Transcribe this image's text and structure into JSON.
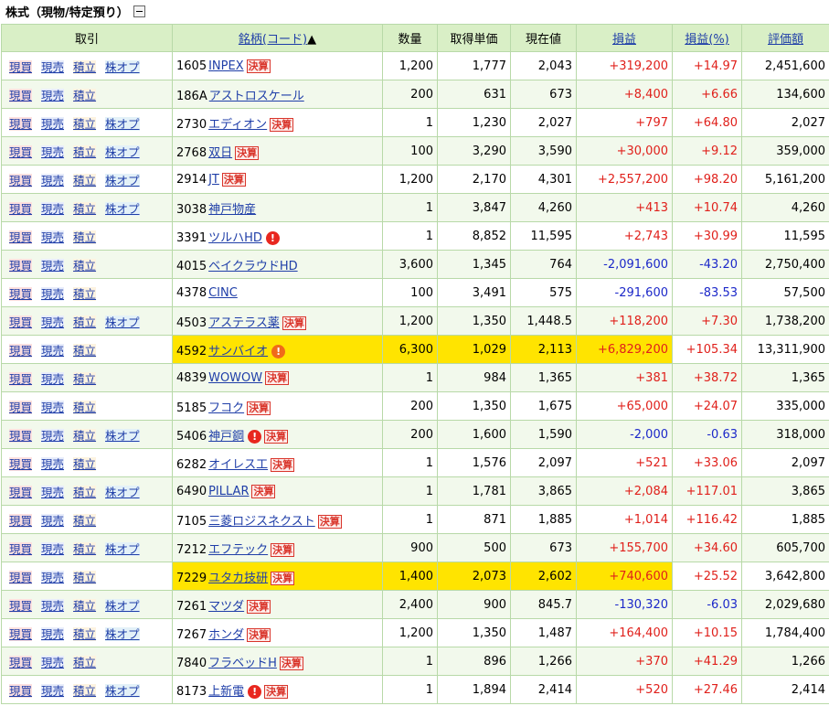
{
  "header": {
    "title": "株式（現物/特定預り）"
  },
  "columns": {
    "trade": "取引",
    "name": "銘柄(コード)",
    "sort_mark": "▲",
    "qty": "数量",
    "cost": "取得単価",
    "price": "現在値",
    "pl": "損益",
    "plpct": "損益(%)",
    "value": "評価額"
  },
  "trade_labels": {
    "buy": "現買",
    "sell": "現売",
    "tsumi": "積立",
    "opt": "株オプ"
  },
  "kessan_label": "決算",
  "alert_glyph": "!",
  "rows": [
    {
      "code": "1605",
      "name": "INPEX",
      "opt": true,
      "kessan": true,
      "alert": "",
      "qty": "1,200",
      "cost": "1,777",
      "price": "2,043",
      "pl": "+319,200",
      "plpct": "+14.97",
      "value": "2,451,600",
      "hl": false
    },
    {
      "code": "186A",
      "name": "アストロスケール",
      "opt": false,
      "kessan": false,
      "alert": "",
      "qty": "200",
      "cost": "631",
      "price": "673",
      "pl": "+8,400",
      "plpct": "+6.66",
      "value": "134,600",
      "hl": false
    },
    {
      "code": "2730",
      "name": "エディオン",
      "opt": true,
      "kessan": true,
      "alert": "",
      "qty": "1",
      "cost": "1,230",
      "price": "2,027",
      "pl": "+797",
      "plpct": "+64.80",
      "value": "2,027",
      "hl": false
    },
    {
      "code": "2768",
      "name": "双日",
      "opt": true,
      "kessan": true,
      "alert": "",
      "qty": "100",
      "cost": "3,290",
      "price": "3,590",
      "pl": "+30,000",
      "plpct": "+9.12",
      "value": "359,000",
      "hl": false
    },
    {
      "code": "2914",
      "name": "JT",
      "opt": true,
      "kessan": true,
      "alert": "",
      "qty": "1,200",
      "cost": "2,170",
      "price": "4,301",
      "pl": "+2,557,200",
      "plpct": "+98.20",
      "value": "5,161,200",
      "hl": false
    },
    {
      "code": "3038",
      "name": "神戸物産",
      "opt": true,
      "kessan": false,
      "alert": "",
      "qty": "1",
      "cost": "3,847",
      "price": "4,260",
      "pl": "+413",
      "plpct": "+10.74",
      "value": "4,260",
      "hl": false
    },
    {
      "code": "3391",
      "name": "ツルハHD",
      "opt": false,
      "kessan": false,
      "alert": "red",
      "qty": "1",
      "cost": "8,852",
      "price": "11,595",
      "pl": "+2,743",
      "plpct": "+30.99",
      "value": "11,595",
      "hl": false
    },
    {
      "code": "4015",
      "name": "ベイクラウドHD",
      "opt": false,
      "kessan": false,
      "alert": "",
      "qty": "3,600",
      "cost": "1,345",
      "price": "764",
      "pl": "-2,091,600",
      "plpct": "-43.20",
      "value": "2,750,400",
      "hl": false
    },
    {
      "code": "4378",
      "name": "CINC",
      "opt": false,
      "kessan": false,
      "alert": "",
      "qty": "100",
      "cost": "3,491",
      "price": "575",
      "pl": "-291,600",
      "plpct": "-83.53",
      "value": "57,500",
      "hl": false
    },
    {
      "code": "4503",
      "name": "アステラス薬",
      "opt": true,
      "kessan": true,
      "alert": "",
      "qty": "1,200",
      "cost": "1,350",
      "price": "1,448.5",
      "pl": "+118,200",
      "plpct": "+7.30",
      "value": "1,738,200",
      "hl": false
    },
    {
      "code": "4592",
      "name": "サンバイオ",
      "opt": false,
      "kessan": false,
      "alert": "orange",
      "qty": "6,300",
      "cost": "1,029",
      "price": "2,113",
      "pl": "+6,829,200",
      "plpct": "+105.34",
      "value": "13,311,900",
      "hl": true
    },
    {
      "code": "4839",
      "name": "WOWOW",
      "opt": false,
      "kessan": true,
      "alert": "",
      "qty": "1",
      "cost": "984",
      "price": "1,365",
      "pl": "+381",
      "plpct": "+38.72",
      "value": "1,365",
      "hl": false
    },
    {
      "code": "5185",
      "name": "フコク",
      "opt": false,
      "kessan": true,
      "alert": "",
      "qty": "200",
      "cost": "1,350",
      "price": "1,675",
      "pl": "+65,000",
      "plpct": "+24.07",
      "value": "335,000",
      "hl": false
    },
    {
      "code": "5406",
      "name": "神戸鋼",
      "opt": true,
      "kessan": true,
      "alert": "red",
      "qty": "200",
      "cost": "1,600",
      "price": "1,590",
      "pl": "-2,000",
      "plpct": "-0.63",
      "value": "318,000",
      "hl": false
    },
    {
      "code": "6282",
      "name": "オイレス工",
      "opt": false,
      "kessan": true,
      "alert": "",
      "qty": "1",
      "cost": "1,576",
      "price": "2,097",
      "pl": "+521",
      "plpct": "+33.06",
      "value": "2,097",
      "hl": false
    },
    {
      "code": "6490",
      "name": "PILLAR",
      "opt": true,
      "kessan": true,
      "alert": "",
      "qty": "1",
      "cost": "1,781",
      "price": "3,865",
      "pl": "+2,084",
      "plpct": "+117.01",
      "value": "3,865",
      "hl": false
    },
    {
      "code": "7105",
      "name": "三菱ロジスネクスト",
      "opt": false,
      "kessan": true,
      "alert": "",
      "qty": "1",
      "cost": "871",
      "price": "1,885",
      "pl": "+1,014",
      "plpct": "+116.42",
      "value": "1,885",
      "hl": false
    },
    {
      "code": "7212",
      "name": "エフテック",
      "opt": true,
      "kessan": true,
      "alert": "",
      "qty": "900",
      "cost": "500",
      "price": "673",
      "pl": "+155,700",
      "plpct": "+34.60",
      "value": "605,700",
      "hl": false
    },
    {
      "code": "7229",
      "name": "ユタカ技研",
      "opt": false,
      "kessan": true,
      "alert": "",
      "qty": "1,400",
      "cost": "2,073",
      "price": "2,602",
      "pl": "+740,600",
      "plpct": "+25.52",
      "value": "3,642,800",
      "hl": true
    },
    {
      "code": "7261",
      "name": "マツダ",
      "opt": true,
      "kessan": true,
      "alert": "",
      "qty": "2,400",
      "cost": "900",
      "price": "845.7",
      "pl": "-130,320",
      "plpct": "-6.03",
      "value": "2,029,680",
      "hl": false
    },
    {
      "code": "7267",
      "name": "ホンダ",
      "opt": true,
      "kessan": true,
      "alert": "",
      "qty": "1,200",
      "cost": "1,350",
      "price": "1,487",
      "pl": "+164,400",
      "plpct": "+10.15",
      "value": "1,784,400",
      "hl": false
    },
    {
      "code": "7840",
      "name": "フラベッドH",
      "opt": false,
      "kessan": true,
      "alert": "",
      "qty": "1",
      "cost": "896",
      "price": "1,266",
      "pl": "+370",
      "plpct": "+41.29",
      "value": "1,266",
      "hl": false
    },
    {
      "code": "8173",
      "name": "上新電",
      "opt": true,
      "kessan": true,
      "alert": "red",
      "qty": "1",
      "cost": "1,894",
      "price": "2,414",
      "pl": "+520",
      "plpct": "+27.46",
      "value": "2,414",
      "hl": false
    }
  ],
  "colors": {
    "positive": "#e0201b",
    "negative": "#1c28c9",
    "highlight": "#ffe400",
    "header_bg": "#d9efc6"
  }
}
